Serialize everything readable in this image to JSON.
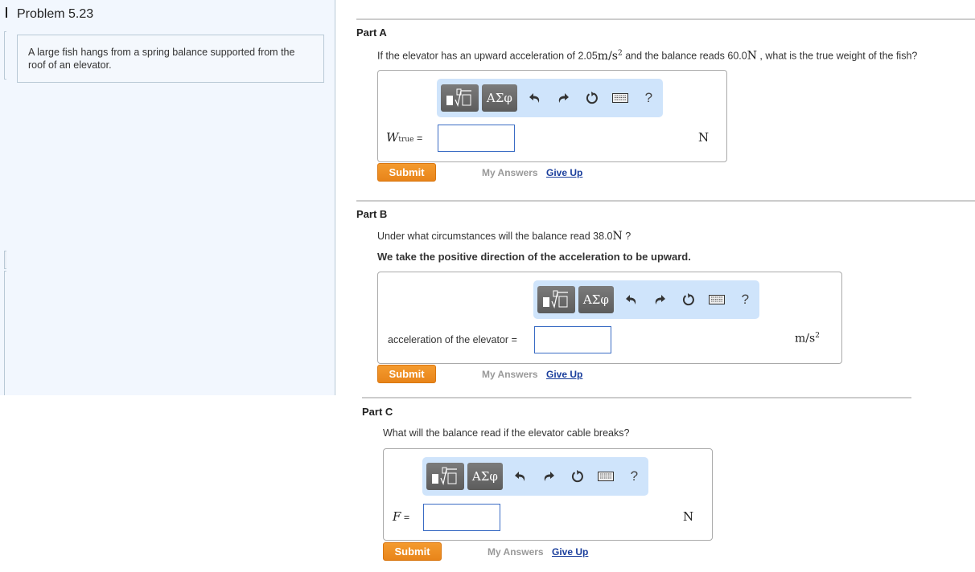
{
  "problem": {
    "title": "Problem 5.23",
    "intro": "A large fish hangs from a spring balance supported from the roof of an elevator."
  },
  "toolbar": {
    "greek_label": "ΑΣφ",
    "help_label": "?",
    "icons": [
      "templates-icon",
      "greek-symbols-icon",
      "undo-icon",
      "redo-icon",
      "reset-icon",
      "keyboard-icon",
      "help-icon"
    ]
  },
  "actions": {
    "submit_label": "Submit",
    "my_answers_label": "My Answers",
    "give_up_label": "Give Up"
  },
  "colors": {
    "submit": "#f0901f",
    "toolbar_bg": "#cfe4fb",
    "left_panel_bg": "#f2f7fe",
    "link": "#1a3e9c",
    "input_border": "#3a6cc4"
  },
  "parts": [
    {
      "title": "Part A",
      "question_pre": "If the elevator has an upward acceleration of 2.05",
      "question_unit1": "m/s",
      "question_unit1_exp": "2",
      "question_mid": " and the balance reads 60.0",
      "question_unit2": "N",
      "question_post": " , what is the true weight of the fish?",
      "answer_var": "W",
      "answer_var_sub": "true",
      "answer_eq": " =",
      "answer_value": "",
      "unit": "N"
    },
    {
      "title": "Part B",
      "question_pre": "Under what circumstances will the balance read 38.0",
      "question_unit": "N",
      "question_post": " ?",
      "instruction": "We take the positive direction of the acceleration to be upward.",
      "answer_label": "acceleration of the elevator =",
      "answer_value": "",
      "unit": "m/s",
      "unit_exp": "2"
    },
    {
      "title": "Part C",
      "question": "What will the balance read if the elevator cable breaks?",
      "answer_var": "F",
      "answer_eq": " =",
      "answer_value": "",
      "unit": "N"
    }
  ]
}
